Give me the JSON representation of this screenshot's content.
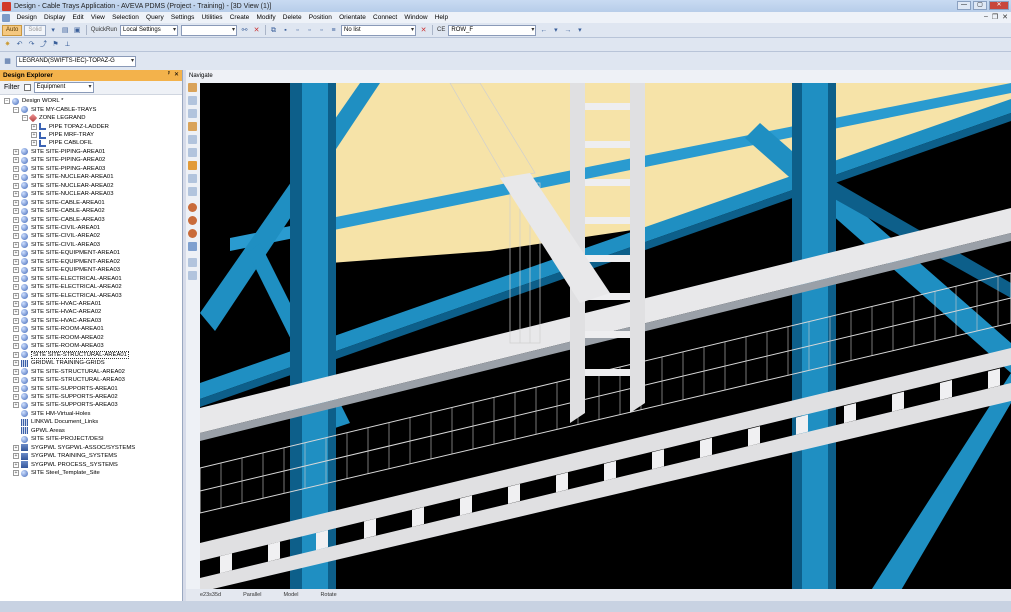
{
  "window": {
    "title": "Design - Cable Trays Application - AVEVA PDMS (Project - Training) - [3D View (1)]",
    "minimize": "—",
    "maximize": "▢",
    "close": "✕"
  },
  "menu": [
    "Design",
    "Display",
    "Edit",
    "View",
    "Selection",
    "Query",
    "Settings",
    "Utilities",
    "Create",
    "Modify",
    "Delete",
    "Position",
    "Orientate",
    "Connect",
    "Window",
    "Help"
  ],
  "toolbar1": {
    "auto_label": "Auto",
    "solid_label": "Solid",
    "quickrun_label": "QuickRun",
    "settings_value": "Local Settings",
    "blank_combo": "",
    "list_value": "No list",
    "ce_label": "CE",
    "ce_value": "ROW_F"
  },
  "toolbar3": {
    "element_value": "LEGRAND(SWIFTS-IEC)-TOPAZ-G"
  },
  "explorer": {
    "title": "Design Explorer",
    "pin": "ᵖ",
    "close": "✕",
    "filter_label": "Filter",
    "filter_value": "Equipment",
    "nodes": [
      {
        "label": "Design WORL *",
        "level": 0,
        "icon": "world",
        "exp": "−"
      },
      {
        "label": "SITE MY-CABLE-TRAYS",
        "level": 1,
        "icon": "site",
        "exp": "−"
      },
      {
        "label": "ZONE LEGRAND",
        "level": 2,
        "icon": "zone",
        "exp": "−"
      },
      {
        "label": "PIPE TOPAZ-LADDER",
        "level": 3,
        "icon": "pipe",
        "exp": "+"
      },
      {
        "label": "PIPE MRF-TRAY",
        "level": 3,
        "icon": "pipe",
        "exp": "+"
      },
      {
        "label": "PIPE CABLOFIL",
        "level": 3,
        "icon": "pipe",
        "exp": "+"
      },
      {
        "label": "SITE SITE-PIPING-AREA01",
        "level": 1,
        "icon": "site",
        "exp": "+"
      },
      {
        "label": "SITE SITE-PIPING-AREA02",
        "level": 1,
        "icon": "site",
        "exp": "+"
      },
      {
        "label": "SITE SITE-PIPING-AREA03",
        "level": 1,
        "icon": "site",
        "exp": "+"
      },
      {
        "label": "SITE SITE-NUCLEAR-AREA01",
        "level": 1,
        "icon": "site",
        "exp": "+"
      },
      {
        "label": "SITE SITE-NUCLEAR-AREA02",
        "level": 1,
        "icon": "site",
        "exp": "+"
      },
      {
        "label": "SITE SITE-NUCLEAR-AREA03",
        "level": 1,
        "icon": "site",
        "exp": "+"
      },
      {
        "label": "SITE SITE-CABLE-AREA01",
        "level": 1,
        "icon": "site",
        "exp": "+"
      },
      {
        "label": "SITE SITE-CABLE-AREA02",
        "level": 1,
        "icon": "site",
        "exp": "+"
      },
      {
        "label": "SITE SITE-CABLE-AREA03",
        "level": 1,
        "icon": "site",
        "exp": "+"
      },
      {
        "label": "SITE SITE-CIVIL-AREA01",
        "level": 1,
        "icon": "site",
        "exp": "+"
      },
      {
        "label": "SITE SITE-CIVIL-AREA02",
        "level": 1,
        "icon": "site",
        "exp": "+"
      },
      {
        "label": "SITE SITE-CIVIL-AREA03",
        "level": 1,
        "icon": "site",
        "exp": "+"
      },
      {
        "label": "SITE SITE-EQUIPMENT-AREA01",
        "level": 1,
        "icon": "site",
        "exp": "+"
      },
      {
        "label": "SITE SITE-EQUIPMENT-AREA02",
        "level": 1,
        "icon": "site",
        "exp": "+"
      },
      {
        "label": "SITE SITE-EQUIPMENT-AREA03",
        "level": 1,
        "icon": "site",
        "exp": "+"
      },
      {
        "label": "SITE SITE-ELECTRICAL-AREA01",
        "level": 1,
        "icon": "site",
        "exp": "+"
      },
      {
        "label": "SITE SITE-ELECTRICAL-AREA02",
        "level": 1,
        "icon": "site",
        "exp": "+"
      },
      {
        "label": "SITE SITE-ELECTRICAL-AREA03",
        "level": 1,
        "icon": "site",
        "exp": "+"
      },
      {
        "label": "SITE SITE-HVAC-AREA01",
        "level": 1,
        "icon": "site",
        "exp": "+"
      },
      {
        "label": "SITE SITE-HVAC-AREA02",
        "level": 1,
        "icon": "site",
        "exp": "+"
      },
      {
        "label": "SITE SITE-HVAC-AREA03",
        "level": 1,
        "icon": "site",
        "exp": "+"
      },
      {
        "label": "SITE SITE-ROOM-AREA01",
        "level": 1,
        "icon": "site",
        "exp": "+"
      },
      {
        "label": "SITE SITE-ROOM-AREA02",
        "level": 1,
        "icon": "site",
        "exp": "+"
      },
      {
        "label": "SITE SITE-ROOM-AREA03",
        "level": 1,
        "icon": "site",
        "exp": "+"
      },
      {
        "label": "SITE SITE-STRUCTURAL-AREA01",
        "level": 1,
        "icon": "site",
        "exp": "+",
        "selected": true
      },
      {
        "label": "GRIDWL TRAINING-GRIDS",
        "level": 1,
        "icon": "grid",
        "exp": "+"
      },
      {
        "label": "SITE SITE-STRUCTURAL-AREA02",
        "level": 1,
        "icon": "site",
        "exp": "+"
      },
      {
        "label": "SITE SITE-STRUCTURAL-AREA03",
        "level": 1,
        "icon": "site",
        "exp": "+"
      },
      {
        "label": "SITE SITE-SUPPORTS-AREA01",
        "level": 1,
        "icon": "site",
        "exp": "+"
      },
      {
        "label": "SITE SITE-SUPPORTS-AREA02",
        "level": 1,
        "icon": "site",
        "exp": "+"
      },
      {
        "label": "SITE SITE-SUPPORTS-AREA03",
        "level": 1,
        "icon": "site",
        "exp": "+"
      },
      {
        "label": "SITE HM-Virtual-Holes",
        "level": 1,
        "icon": "site",
        "exp": ""
      },
      {
        "label": "LINKWL Document_Links",
        "level": 1,
        "icon": "grid",
        "exp": ""
      },
      {
        "label": "GPWL Areas",
        "level": 1,
        "icon": "grid",
        "exp": ""
      },
      {
        "label": "SITE SITE-PROJECT/DESI",
        "level": 1,
        "icon": "site",
        "exp": ""
      },
      {
        "label": "SYGPWL SYGPWL-ASSOC/SYSTEMS",
        "level": 1,
        "icon": "sys",
        "exp": "+"
      },
      {
        "label": "SYGPWL TRAINING_SYSTEMS",
        "level": 1,
        "icon": "sys",
        "exp": "+"
      },
      {
        "label": "SYGPWL PROCESS_SYSTEMS",
        "level": 1,
        "icon": "sys",
        "exp": "+"
      },
      {
        "label": "SITE Steel_Template_Site",
        "level": 1,
        "icon": "site",
        "exp": "+"
      }
    ]
  },
  "viewport": {
    "title": "Navigate"
  },
  "status": {
    "code": "e23s35d",
    "projection": "Parallel",
    "mode": "Model",
    "action": "Rotate"
  },
  "colors": {
    "steel": "#1f8fc2",
    "steel_dark": "#0d5f8a",
    "ceiling": "#f6e3a8",
    "tray": "#e8e8ea",
    "background": "#000000",
    "panel_header": "#f3b24b"
  }
}
